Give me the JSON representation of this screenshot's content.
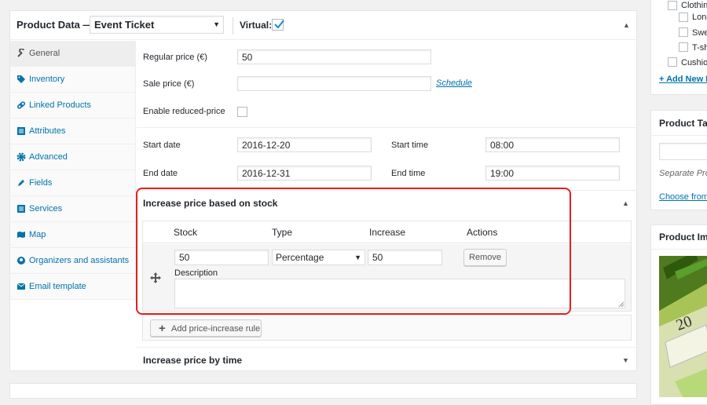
{
  "product_data": {
    "title": "Product Data —",
    "type_selected": "Event Ticket",
    "virtual_label": "Virtual:",
    "virtual_checked": true
  },
  "tabs": [
    {
      "label": "General",
      "icon": "wrench-icon",
      "active": true
    },
    {
      "label": "Inventory",
      "icon": "tag-icon"
    },
    {
      "label": "Linked Products",
      "icon": "link-icon"
    },
    {
      "label": "Attributes",
      "icon": "list-icon"
    },
    {
      "label": "Advanced",
      "icon": "gear-icon"
    },
    {
      "label": "Fields",
      "icon": "pencil-icon"
    },
    {
      "label": "Services",
      "icon": "list-icon"
    },
    {
      "label": "Map",
      "icon": "map-icon"
    },
    {
      "label": "Organizers and assistants",
      "icon": "people-icon"
    },
    {
      "label": "Email template",
      "icon": "email-icon"
    }
  ],
  "general": {
    "regular_price_label": "Regular price (€)",
    "regular_price_value": "50",
    "sale_price_label": "Sale price (€)",
    "sale_price_value": "",
    "schedule_link": "Schedule",
    "reduced_price_label": "Enable reduced-price",
    "start_date_label": "Start date",
    "start_date_value": "2016-12-20",
    "start_time_label": "Start time",
    "start_time_value": "08:00",
    "end_date_label": "End date",
    "end_date_value": "2016-12-31",
    "end_time_label": "End time",
    "end_time_value": "19:00"
  },
  "stock_rules": {
    "title": "Increase price based on stock",
    "columns": [
      "Stock",
      "Type",
      "Increase",
      "Actions"
    ],
    "row": {
      "stock": "50",
      "type": "Percentage",
      "increase": "50",
      "remove_label": "Remove",
      "description_label": "Description",
      "description_value": ""
    },
    "add_label": "Add price-increase rule"
  },
  "time_rules": {
    "title": "Increase price by time"
  },
  "sidebar": {
    "categories": [
      "Clothing",
      "Long",
      "Swe",
      "T-sh",
      "Cushion"
    ],
    "add_new_link": "+ Add New P",
    "tags_title": "Product Tag",
    "tags_hint": "Separate Prod",
    "tags_choose_link": "Choose from",
    "image_title": "Product Ima",
    "image_label": "20"
  },
  "colors": {
    "link": "#0073aa",
    "highlight": "#e02020",
    "check": "#1e8cbe"
  }
}
